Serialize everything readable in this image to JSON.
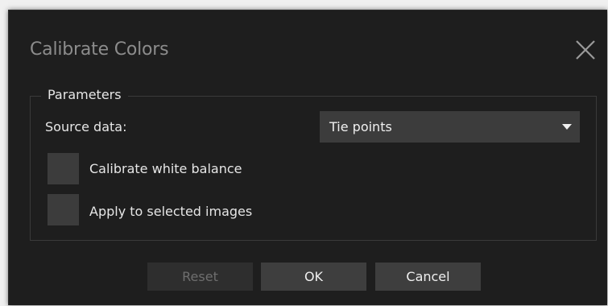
{
  "dialog": {
    "title": "Calibrate Colors",
    "close_icon": "close-icon"
  },
  "parameters": {
    "group_title": "Parameters",
    "source_data_label": "Source data:",
    "source_data_value": "Tie points",
    "calibrate_white_balance_label": "Calibrate white balance",
    "calibrate_white_balance_checked": false,
    "apply_selected_label": "Apply to selected images",
    "apply_selected_checked": false
  },
  "buttons": {
    "reset": "Reset",
    "ok": "OK",
    "cancel": "Cancel",
    "reset_enabled": false
  },
  "colors": {
    "dialog_bg": "#1e1e1e",
    "control_bg": "#3c3c3c",
    "text": "#e6e6e6",
    "title_text": "#8c8c8c",
    "disabled_text": "#6e6e6e"
  }
}
